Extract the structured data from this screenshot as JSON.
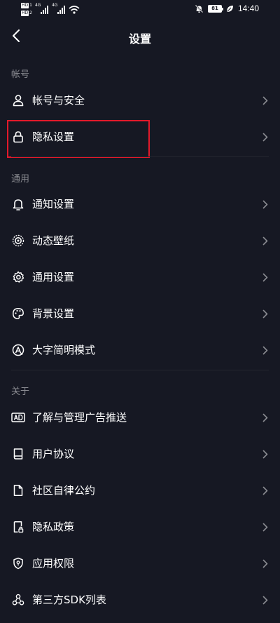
{
  "status_bar": {
    "sim1_badge": "HD",
    "sim1_num": "1",
    "sim2_badge": "HD",
    "sim2_num": "2",
    "net1": "4G",
    "net2": "4G",
    "battery": "81",
    "time": "14:40"
  },
  "header": {
    "title": "设置"
  },
  "sections": {
    "account": {
      "title": "帐号",
      "items": [
        {
          "label": "帐号与安全",
          "icon": "person-icon"
        },
        {
          "label": "隐私设置",
          "icon": "lock-icon"
        }
      ]
    },
    "general": {
      "title": "通用",
      "items": [
        {
          "label": "通知设置",
          "icon": "bell-icon"
        },
        {
          "label": "动态壁纸",
          "icon": "live-wallpaper-icon"
        },
        {
          "label": "通用设置",
          "icon": "gear-icon"
        },
        {
          "label": "背景设置",
          "icon": "palette-icon"
        },
        {
          "label": "大字简明模式",
          "icon": "large-font-icon"
        }
      ]
    },
    "about": {
      "title": "关于",
      "items": [
        {
          "label": "了解与管理广告推送",
          "icon": "ad-icon"
        },
        {
          "label": "用户协议",
          "icon": "book-icon"
        },
        {
          "label": "社区自律公约",
          "icon": "document-icon"
        },
        {
          "label": "隐私政策",
          "icon": "privacy-policy-icon"
        },
        {
          "label": "应用权限",
          "icon": "shield-icon"
        },
        {
          "label": "第三方SDK列表",
          "icon": "sdk-icon"
        }
      ]
    }
  },
  "colors": {
    "background": "#161823",
    "text": "#ffffff",
    "section_header": "#8a8b91",
    "chevron": "#8a8b91",
    "highlight": "#e3192a"
  }
}
